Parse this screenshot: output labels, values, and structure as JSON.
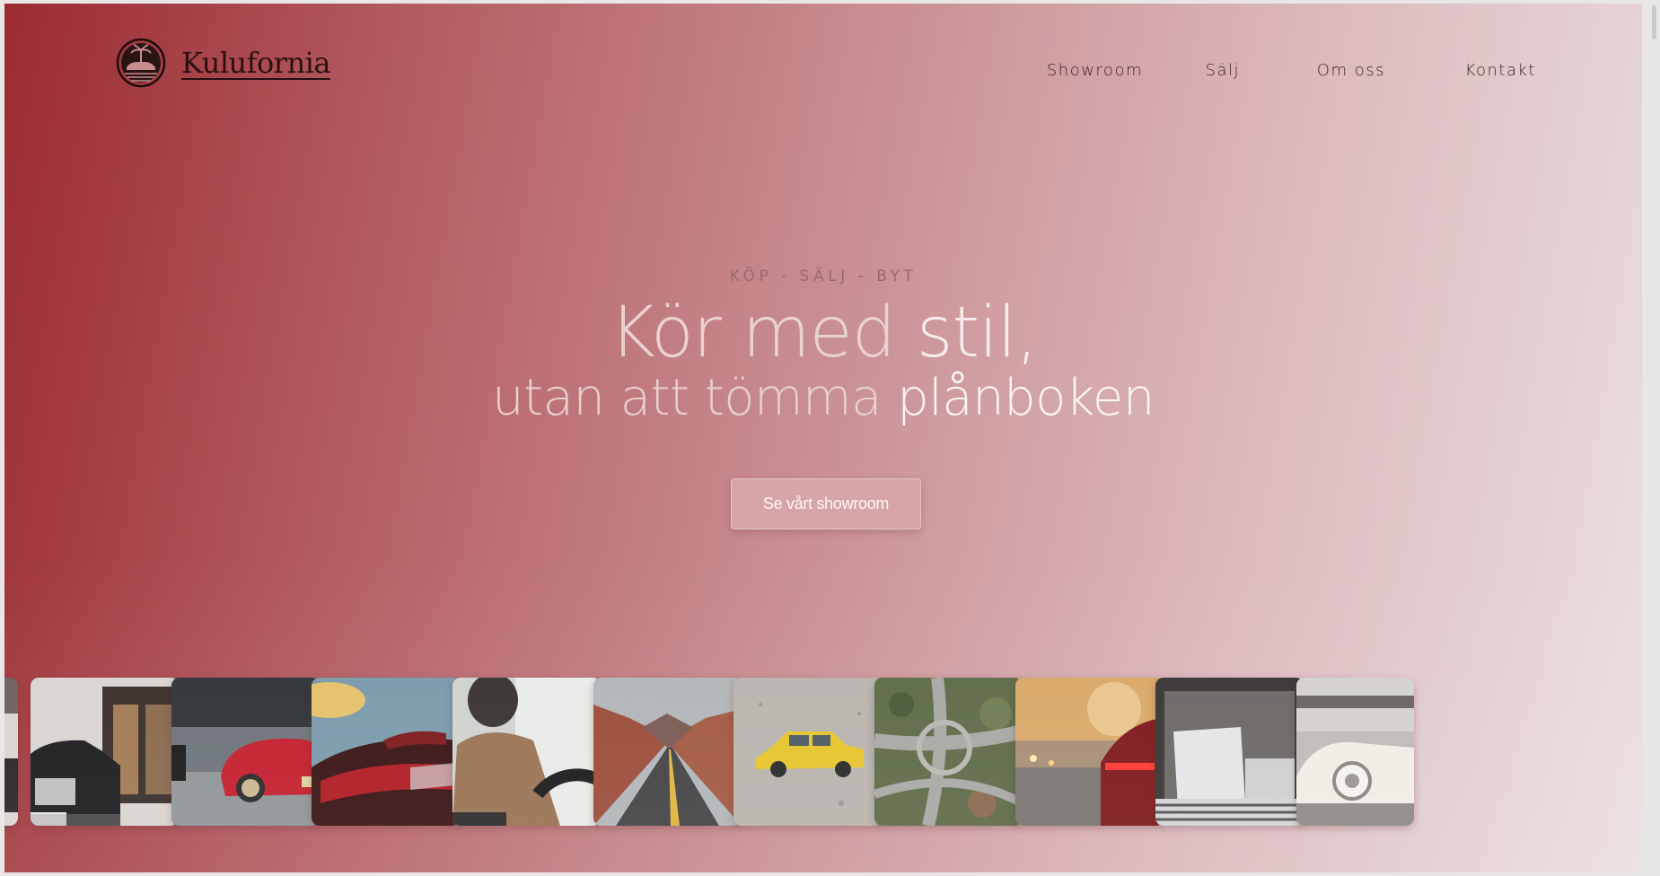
{
  "brand": {
    "name": "Kulufornia",
    "logo_icon": "palm-car-emblem-icon"
  },
  "nav": {
    "items": [
      {
        "label": "Showroom"
      },
      {
        "label": "Sälj"
      },
      {
        "label": "Om oss"
      },
      {
        "label": "Kontakt"
      }
    ]
  },
  "hero": {
    "eyebrow": "KÖP - SÄLJ - BYT",
    "headline_light": "Kör med ",
    "headline_strong": "stil,",
    "subline_light": "utan att tömma ",
    "subline_strong": "plånboken",
    "cta_label": "Se vårt showroom"
  },
  "gallery": {
    "images": [
      {
        "subject": "cropped-car-photo"
      },
      {
        "subject": "black-rolls-royce"
      },
      {
        "subject": "red-porsche"
      },
      {
        "subject": "red-car-tail-light"
      },
      {
        "subject": "driver-at-wheel"
      },
      {
        "subject": "desert-road"
      },
      {
        "subject": "yellow-toy-car"
      },
      {
        "subject": "highway-interchange"
      },
      {
        "subject": "red-audi-city"
      },
      {
        "subject": "car-trunk-interior"
      },
      {
        "subject": "white-vintage-car"
      }
    ]
  },
  "colors": {
    "gradient_start": "#9b2b31",
    "gradient_end": "#ece0e1",
    "cta_bg": "#d7a5a8",
    "text_dark": "#2a1010"
  }
}
